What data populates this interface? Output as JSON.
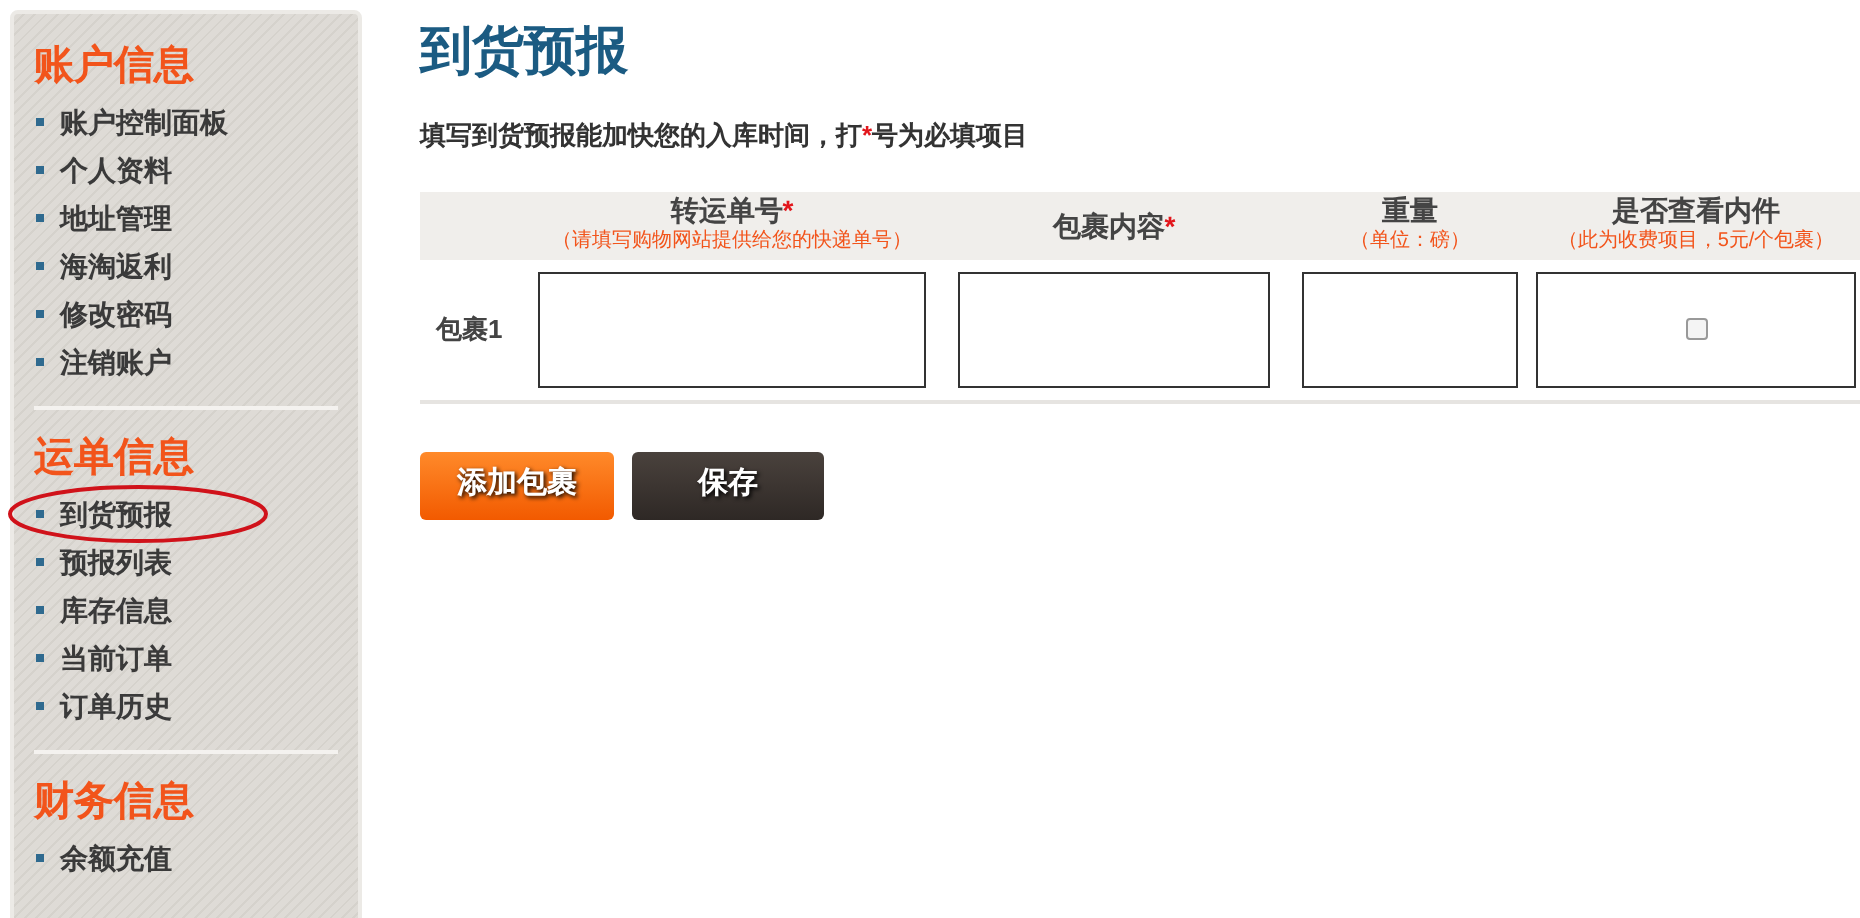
{
  "sidebar": {
    "sections": [
      {
        "title": "账户信息",
        "items": [
          "账户控制面板",
          "个人资料",
          "地址管理",
          "海淘返利",
          "修改密码",
          "注销账户"
        ]
      },
      {
        "title": "运单信息",
        "items": [
          "到货预报",
          "预报列表",
          "库存信息",
          "当前订单",
          "订单历史"
        ]
      },
      {
        "title": "财务信息",
        "items": [
          "余额充值"
        ]
      }
    ]
  },
  "page_title": "到货预报",
  "instruction": {
    "before": "填写到货预报能加快您的入库时间，打",
    "mark": "*",
    "after": "号为必填项目"
  },
  "table": {
    "columns": [
      {
        "label": "转运单号",
        "required_mark": "*",
        "hint": "（请填写购物网站提供给您的快递单号）",
        "kind": "text"
      },
      {
        "label": "包裹内容",
        "required_mark": "*",
        "kind": "text"
      },
      {
        "label": "重量",
        "hint": "（单位：磅）",
        "kind": "text"
      },
      {
        "label": "是否查看内件",
        "hint": "（此为收费项目，5元/个包裹）",
        "kind": "checkbox"
      }
    ],
    "rows": [
      {
        "label": "包裹1",
        "inspect_checked": false
      }
    ]
  },
  "buttons": [
    {
      "label": "添加包裹",
      "kind": "add"
    },
    {
      "label": "保存",
      "kind": "save"
    }
  ]
}
